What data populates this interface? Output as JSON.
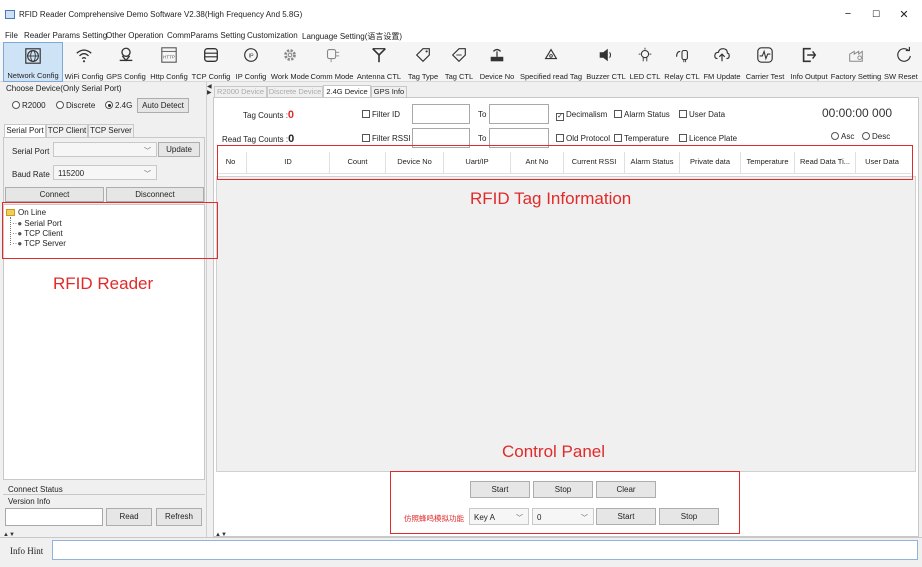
{
  "window": {
    "title": "RFID Reader Comprehensive Demo Software V2.38(High Frequency And 5.8G)",
    "minimize": "−",
    "maximize": "☐",
    "close": "✕"
  },
  "menu": [
    "File",
    "Reader Params Setting",
    "Other Operation",
    "CommParams Setting",
    "Customization",
    "Language Setting(语言设置)"
  ],
  "toolbar": [
    {
      "label": "Network Config",
      "icon": "globe-icon"
    },
    {
      "label": "WiFi Config",
      "icon": "wifi-icon"
    },
    {
      "label": "GPS Config",
      "icon": "location-icon"
    },
    {
      "label": "Http Config",
      "icon": "http-icon",
      "icon_text": "HTTP"
    },
    {
      "label": "TCP Config",
      "icon": "database-icon"
    },
    {
      "label": "IP Config",
      "icon": "ip-icon",
      "icon_text": "IP"
    },
    {
      "label": "Work Mode",
      "icon": "gear-icon"
    },
    {
      "label": "Comm Mode",
      "icon": "plug-icon"
    },
    {
      "label": "Antenna CTL",
      "icon": "antenna-icon"
    },
    {
      "label": "Tag Type",
      "icon": "tag-icon"
    },
    {
      "label": "Tag CTL",
      "icon": "tag-control-icon"
    },
    {
      "label": "Device No",
      "icon": "router-icon"
    },
    {
      "label": "Specified read Tag",
      "icon": "specified-tag-icon"
    },
    {
      "label": "Buzzer CTL",
      "icon": "speaker-icon"
    },
    {
      "label": "LED CTL",
      "icon": "led-icon"
    },
    {
      "label": "Relay CTL",
      "icon": "relay-icon"
    },
    {
      "label": "FM Update",
      "icon": "upload-icon"
    },
    {
      "label": "Carrier Test",
      "icon": "pulse-icon"
    },
    {
      "label": "Info Output",
      "icon": "export-icon"
    },
    {
      "label": "Factory Setting",
      "icon": "factory-icon"
    },
    {
      "label": "SW Reset",
      "icon": "reset-icon"
    }
  ],
  "left": {
    "choose_device": "Choose Device(Only Serial Port)",
    "radios": [
      "R2000",
      "Discrete",
      "2.4G"
    ],
    "auto_detect": "Auto Detect",
    "tabs": [
      "Serial Port",
      "TCP Client",
      "TCP Server"
    ],
    "serial_port_label": "Serial Port",
    "serial_port_value": "",
    "update": "Update",
    "baud_label": "Baud Rate",
    "baud_value": "115200",
    "connect": "Connect",
    "disconnect": "Disconnect",
    "tree_root": "On Line",
    "tree_items": [
      "Serial Port",
      "TCP Client",
      "TCP Server"
    ],
    "connect_status": "Connect Status",
    "version_info": "Version Info",
    "read": "Read",
    "refresh": "Refresh"
  },
  "main": {
    "tabs": [
      "R2000 Device",
      "Discrete Device",
      "2.4G Device",
      "GPS Info"
    ],
    "tag_counts_label": "Tag Counts :",
    "tag_counts_value": "0",
    "read_tag_counts_label": "Read Tag Counts :",
    "read_tag_counts_value": "0",
    "filter_id": "Filter ID",
    "filter_rssi": "Filter RSSI",
    "to": "To",
    "decimalism": "Decimalism",
    "alarm_status": "Alarm Status",
    "user_data": "User Data",
    "old_protocol": "Old Protocol",
    "temperature": "Temperature",
    "licence_plate": "Licence Plate",
    "timer": "00:00:00 000",
    "asc": "Asc",
    "desc": "Desc",
    "columns": [
      "No",
      "ID",
      "Count",
      "Device No",
      "Uart/IP",
      "Ant No",
      "Current RSSI",
      "Alarm Status",
      "Private data",
      "Temperature",
      "Read Data Ti...",
      "User Data"
    ],
    "start": "Start",
    "stop": "Stop",
    "clear": "Clear",
    "hidden_func_label": "仿照蜂鸣模拟功能",
    "key_value": "Key A",
    "num_value": "0",
    "start2": "Start",
    "stop2": "Stop"
  },
  "annotations": {
    "reader": "RFID Reader",
    "tag_info": "RFID Tag Information",
    "control_panel": "Control Panel"
  },
  "status_bar": {
    "info_hint": "Info Hint"
  },
  "colors": {
    "annotation_red": "#e12a2a",
    "tag_count_red": "#e12a2a",
    "selected_tool": "#cfe3f7"
  }
}
